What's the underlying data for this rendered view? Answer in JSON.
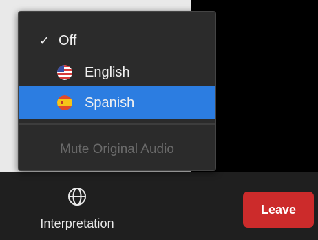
{
  "menu": {
    "items": [
      {
        "label": "Off",
        "checked": true
      },
      {
        "label": "English",
        "icon": "us-flag-icon"
      },
      {
        "label": "Spanish",
        "icon": "spain-flag-icon",
        "highlighted": true
      }
    ],
    "mute_label": "Mute Original Audio",
    "check_glyph": "✓"
  },
  "toolbar": {
    "interpretation_label": "Interpretation",
    "interpretation_icon": "globe-icon",
    "leave_label": "Leave"
  },
  "colors": {
    "highlight": "#2c7de1",
    "leave": "#cc2b2b",
    "menu_bg": "#2b2b2b",
    "disabled_text": "#6a6a6a"
  }
}
